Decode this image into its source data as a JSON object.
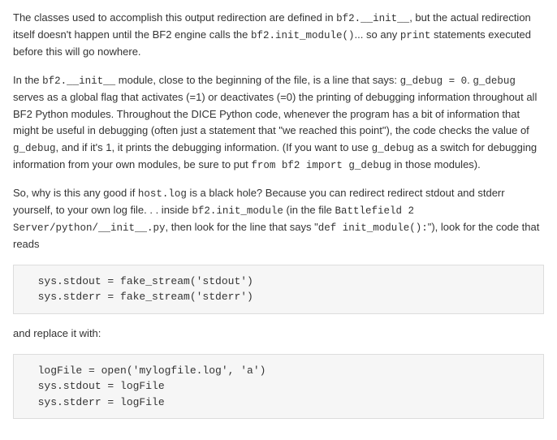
{
  "paragraphs": {
    "p1_a": "The classes used to accomplish this output redirection are defined in ",
    "p1_c1": "bf2.__init__",
    "p1_b": ", but the actual redirection itself doesn't happen until the BF2 engine calls the ",
    "p1_c2": "bf2.init_module()",
    "p1_c": "... so any ",
    "p1_c3": "print",
    "p1_d": " statements executed before this will go nowhere.",
    "p2_a": "In the ",
    "p2_c1": "bf2.__init__",
    "p2_b": " module, close to the beginning of the file, is a line that says: ",
    "p2_c2": "g_debug = 0",
    "p2_c": ". ",
    "p2_c3": "g_debug",
    "p2_d": " serves as a global flag that activates (=1) or deactivates (=0) the printing of debugging information throughout all BF2 Python modules. Throughout the DICE Python code, whenever the program has a bit of information that might be useful in debugging (often just a statement that \"we reached this point\"), the code checks the value of ",
    "p2_c4": "g_debug",
    "p2_e": ", and if it's 1, it prints the debugging information. (If you want to use ",
    "p2_c5": "g_debug",
    "p2_f": " as a switch for debugging information from your own modules, be sure to put ",
    "p2_c6": "from bf2 import g_debug",
    "p2_g": " in those modules).",
    "p3_a": "So, why is this any good if ",
    "p3_c1": "host.log",
    "p3_b": " is a black hole? Because you can redirect redirect stdout and stderr yourself, to your own log file. . . inside ",
    "p3_c2": "bf2.init_module",
    "p3_c": " (in the file ",
    "p3_c3": "Battlefield 2 Server/python/__init__.py",
    "p3_d": ", then look for the line that says \"",
    "p3_c4": "def init_module():",
    "p3_e": "\"), look for the code that reads",
    "between": "and replace it with:"
  },
  "code1": "  sys.stdout = fake_stream('stdout')\n  sys.stderr = fake_stream('stderr')",
  "code2": "  logFile = open('mylogfile.log', 'a')\n  sys.stdout = logFile\n  sys.stderr = logFile"
}
